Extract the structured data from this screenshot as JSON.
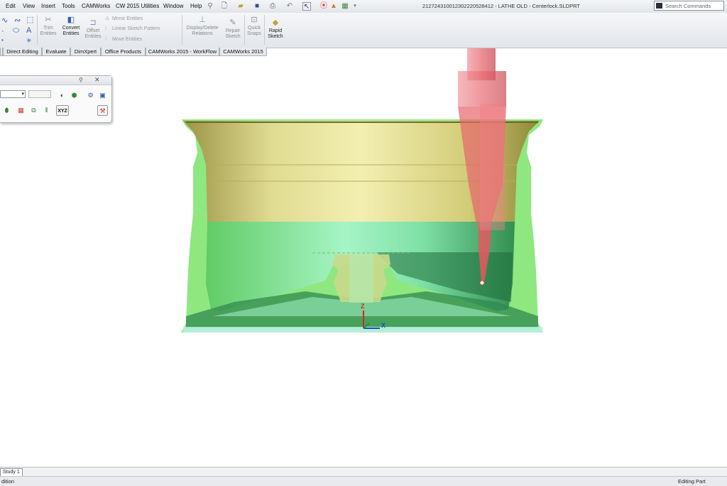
{
  "menu": {
    "items": [
      "Edit",
      "View",
      "Insert",
      "Tools",
      "CAMWorks",
      "CW 2015 Utilities",
      "Window",
      "Help"
    ],
    "title": "212724310012302220528412 - LATHE OLD - Centerlock.SLDPRT",
    "search_placeholder": "Search Commands"
  },
  "commands": {
    "trim": "Trim\nEntities",
    "convert": "Convert\nEntities",
    "offset": "Offset\nEntities",
    "mirror": "Mirror Entities",
    "linear": "Linear Sketch Pattern",
    "move": "Move Entities",
    "display_delete": "Display/Delete\nRelations",
    "repair": "Repair\nSketch",
    "quick_snaps": "Quick\nSnaps",
    "rapid_sketch": "Rapid\nSketch"
  },
  "tabs": [
    "Direct Editing",
    "Evaluate",
    "DimXpert",
    "Office Products",
    "CAMWorks 2015 - WorkFlow",
    "CAMWorks 2015"
  ],
  "panel": {
    "xyz_label": "XYZ"
  },
  "triad": {
    "z": "Z",
    "x": "X"
  },
  "bottom": {
    "study_tab": "Study 1",
    "status_left": "dition",
    "status_right": "Editing Part"
  },
  "colors": {
    "wheel_gold": "#d9d68a",
    "wheel_green": "#74e06a",
    "tool_red": "#e8737a",
    "accent_blue": "#2e5aa8"
  }
}
